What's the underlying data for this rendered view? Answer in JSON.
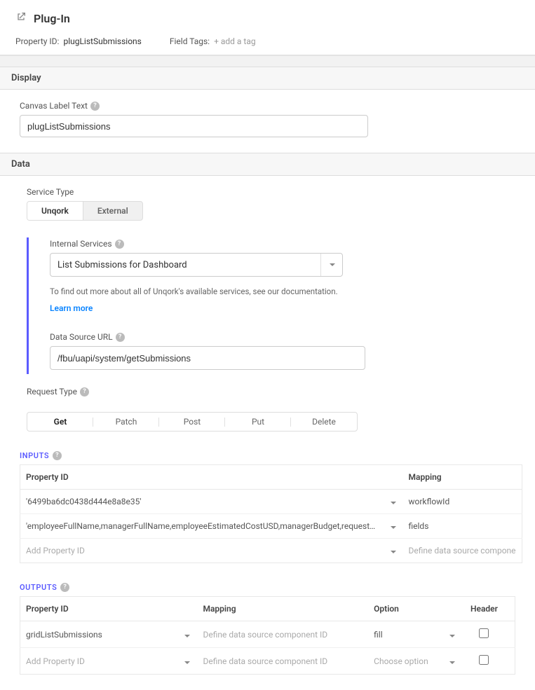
{
  "header": {
    "title": "Plug-In",
    "property_id_label": "Property ID:",
    "property_id_value": "plugListSubmissions",
    "field_tags_label": "Field Tags:",
    "add_tag_label": "add a tag"
  },
  "display": {
    "section_title": "Display",
    "canvas_label_text_label": "Canvas Label Text",
    "canvas_label_text_value": "plugListSubmissions"
  },
  "data": {
    "section_title": "Data",
    "service_type_label": "Service Type",
    "service_type_options": [
      "Unqork",
      "External"
    ],
    "service_type_selected": "Unqork",
    "internal_services_label": "Internal Services",
    "internal_services_value": "List Submissions for Dashboard",
    "documentation_text": "To find out more about all of Unqork's available services, see our documentation.",
    "learn_more_label": "Learn more",
    "data_source_url_label": "Data Source URL",
    "data_source_url_value": "/fbu/uapi/system/getSubmissions",
    "request_type_label": "Request Type",
    "request_type_options": [
      "Get",
      "Patch",
      "Post",
      "Put",
      "Delete"
    ],
    "request_type_selected": "Get"
  },
  "inputs": {
    "section_label": "INPUTS",
    "columns": {
      "property_id": "Property ID",
      "mapping": "Mapping"
    },
    "rows": [
      {
        "property_id": "6499ba6dc0438d444e8a8e35",
        "mapping": "workflowId"
      },
      {
        "property_id": "employeeFullName,managerFullName,employeeEstimatedCostUSD,managerBudget,requestStatus",
        "mapping": "fields"
      }
    ],
    "placeholder_row": {
      "property_id": "Add Property ID",
      "mapping": "Define data source compone"
    }
  },
  "outputs": {
    "section_label": "OUTPUTS",
    "columns": {
      "property_id": "Property ID",
      "mapping": "Mapping",
      "option": "Option",
      "header": "Header"
    },
    "rows": [
      {
        "property_id": "gridListSubmissions",
        "mapping_placeholder": "Define data source component ID",
        "option": "fill",
        "header_checked": false
      }
    ],
    "placeholder_row": {
      "property_id": "Add Property ID",
      "mapping": "Define data source component ID",
      "option": "Choose option",
      "header_checked": false
    }
  }
}
